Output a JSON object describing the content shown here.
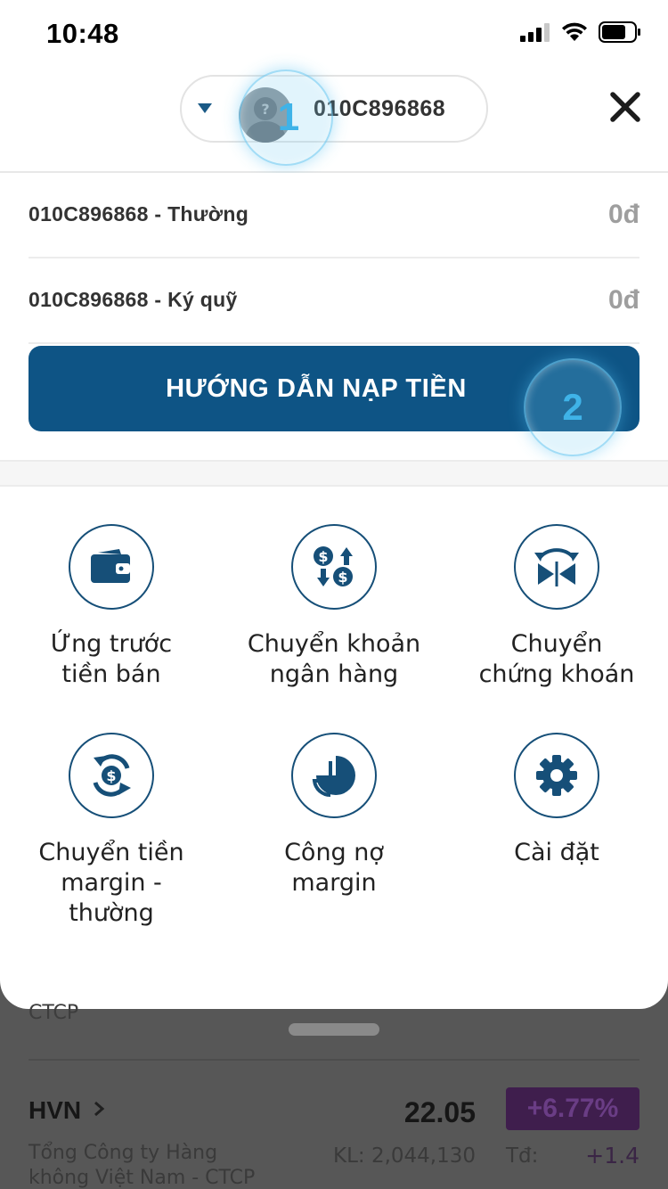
{
  "status_bar": {
    "time": "10:48",
    "signal_icon": "cellular-signal-icon",
    "wifi_icon": "wifi-icon",
    "battery_icon": "battery-icon"
  },
  "header": {
    "account_selector": {
      "account": "010C896868",
      "caret_icon": "caret-down-icon",
      "avatar_icon": "avatar-placeholder-icon"
    },
    "close_icon": "close-icon"
  },
  "tour": {
    "step_1": "1",
    "step_2": "2",
    "highlight_color": "#3fb3e8"
  },
  "accounts": [
    {
      "name": "010C896868 - Thường",
      "balance": "0đ"
    },
    {
      "name": "010C896868 - Ký quỹ",
      "balance": "0đ"
    }
  ],
  "deposit_button": {
    "label": "HƯỚNG DẪN NẠP TIỀN",
    "color": "#0e5485"
  },
  "menu": [
    {
      "label": "Ứng trước\ntiền bán",
      "icon": "wallet-icon"
    },
    {
      "label": "Chuyển khoản\nngân hàng",
      "icon": "money-transfer-icon"
    },
    {
      "label": "Chuyển\nchứng khoán",
      "icon": "stock-transfer-icon"
    },
    {
      "label": "Chuyển tiền\nmargin -\nthường",
      "icon": "money-exchange-icon"
    },
    {
      "label": "Công nợ\nmargin",
      "icon": "pie-chart-icon"
    },
    {
      "label": "Cài đặt",
      "icon": "gear-icon"
    }
  ],
  "background_list": {
    "prev_company_tail": "CTCP",
    "row": {
      "ticker": "HVN",
      "price": "22.05",
      "change": "+6.77%",
      "company": "Tổng Công ty Hàng\nkhông Việt Nam - CTCP",
      "volume_label": "KL: 2,044,130",
      "td_label": "Tđ:",
      "td_value": "+1.4"
    }
  }
}
